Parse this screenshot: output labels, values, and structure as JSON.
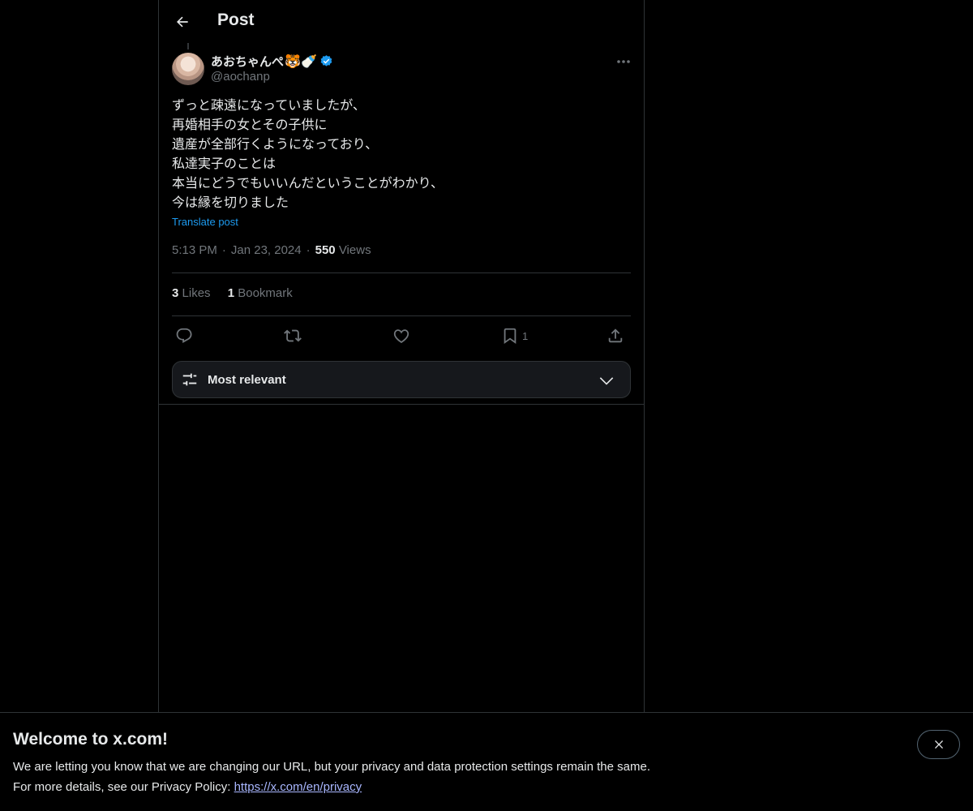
{
  "header": {
    "title": "Post"
  },
  "author": {
    "display_name": "あおちゃんぺ",
    "name_emojis": "🐯🍼",
    "handle": "@aochanp"
  },
  "post": {
    "lines": [
      "ずっと疎遠になっていましたが、",
      "再婚相手の女とその子供に",
      "遺産が全部行くようになっており、",
      "私達実子のことは",
      "本当にどうでもいいんだということがわかり、",
      "今は縁を切りました"
    ],
    "translate_label": "Translate post",
    "time": "5:13 PM",
    "date": "Jan 23, 2024",
    "views_count": "550",
    "views_label": "Views"
  },
  "stats": {
    "likes_count": "3",
    "likes_label": "Likes",
    "bookmarks_count": "1",
    "bookmarks_label": "Bookmark"
  },
  "actions": {
    "bookmark_count": "1"
  },
  "sort": {
    "label": "Most relevant"
  },
  "banner": {
    "title": "Welcome to x.com!",
    "line1": "We are letting you know that we are changing our URL, but your privacy and data protection settings remain the same.",
    "line2_prefix": "For more details, see our Privacy Policy: ",
    "link": "https://x.com/en/privacy"
  },
  "colors": {
    "background": "#000000",
    "text": "#e7e9ea",
    "muted": "#71767b",
    "accent": "#1d9bf0",
    "border": "#2f3336"
  }
}
